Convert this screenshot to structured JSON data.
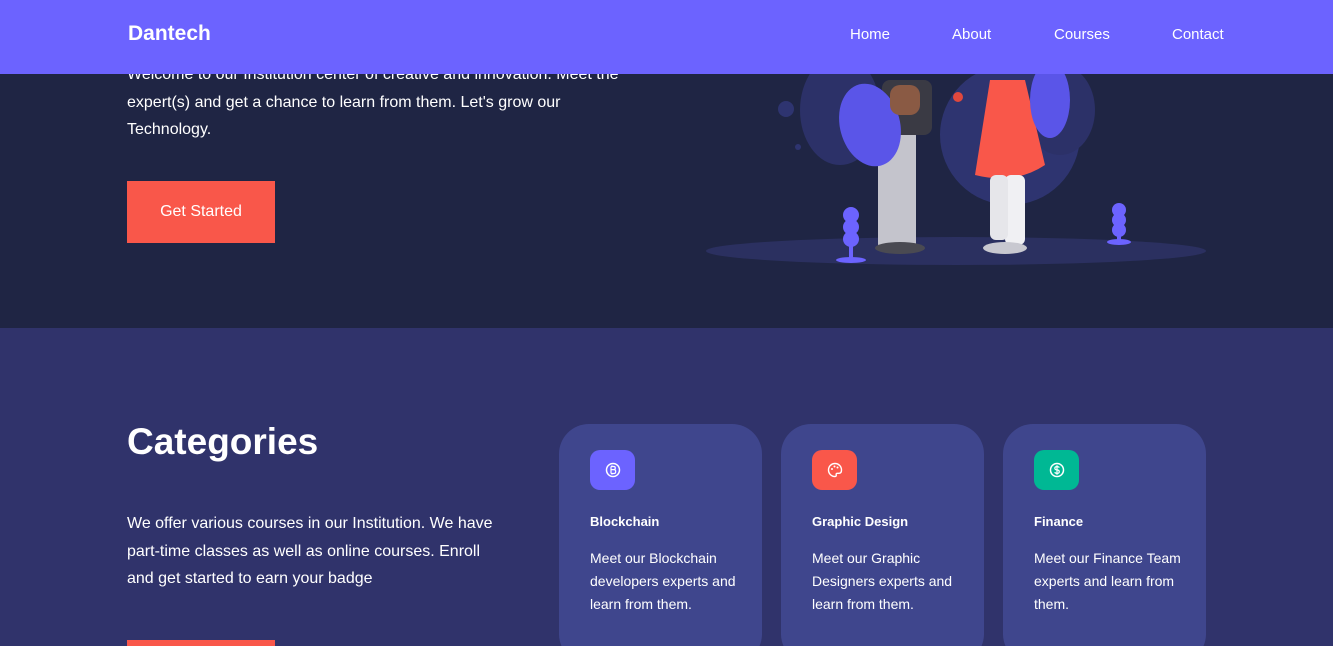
{
  "navbar": {
    "brand": "Dantech",
    "links": [
      "Home",
      "About",
      "Courses",
      "Contact"
    ]
  },
  "hero": {
    "text": "Welcome to our Institution center of creative and innovation. Meet the expert(s) and get a chance to learn from them. Let's grow our Technology.",
    "button_label": "Get Started"
  },
  "categories": {
    "title": "Categories",
    "description": "We offer various courses in our Institution. We have part-time classes as well as online courses. Enroll and get started to earn your badge",
    "cards": [
      {
        "title": "Blockchain",
        "text": "Meet our Blockchain developers experts and learn from them.",
        "icon": "bitcoin-icon",
        "color": "#6c63ff"
      },
      {
        "title": "Graphic Design",
        "text": "Meet our Graphic Designers experts and learn from them.",
        "icon": "palette-icon",
        "color": "#f9574a"
      },
      {
        "title": "Finance",
        "text": "Meet our Finance Team experts and learn from them.",
        "icon": "dollar-icon",
        "color": "#00b894"
      }
    ]
  },
  "colors": {
    "navbar": "#6c63ff",
    "hero_bg": "#1f2544",
    "section_bg": "#30336b",
    "card_bg": "#3f468d",
    "accent": "#f9574a"
  }
}
